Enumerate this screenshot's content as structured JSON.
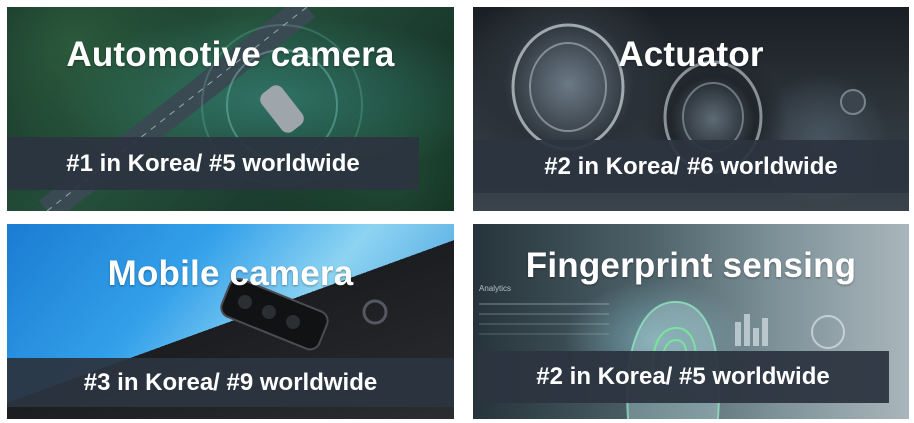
{
  "tiles": [
    {
      "title": "Automotive camera",
      "rank": "#1 in Korea/ #5 worldwide"
    },
    {
      "title": "Actuator",
      "rank": "#2 in Korea/ #6 worldwide"
    },
    {
      "title": "Mobile camera",
      "rank": "#3 in Korea/ #9 worldwide"
    },
    {
      "title": "Fingerprint sensing",
      "rank": "#2 in Korea/ #5 worldwide",
      "decor_label": "Analytics"
    }
  ],
  "colors": {
    "banner": "#2c3440",
    "text": "#ffffff"
  }
}
